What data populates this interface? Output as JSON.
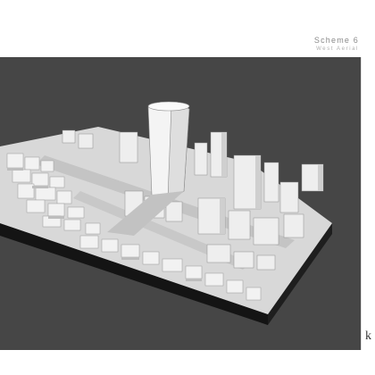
{
  "header": {
    "title": "Scheme 6",
    "subtitle": "West Aerial"
  },
  "render": {
    "description_icon": "3d-massing-model",
    "background_color": "#464646",
    "model_color": "#e8e8e8",
    "base_color": "#1c1c1c"
  },
  "logo": {
    "text": "k"
  }
}
